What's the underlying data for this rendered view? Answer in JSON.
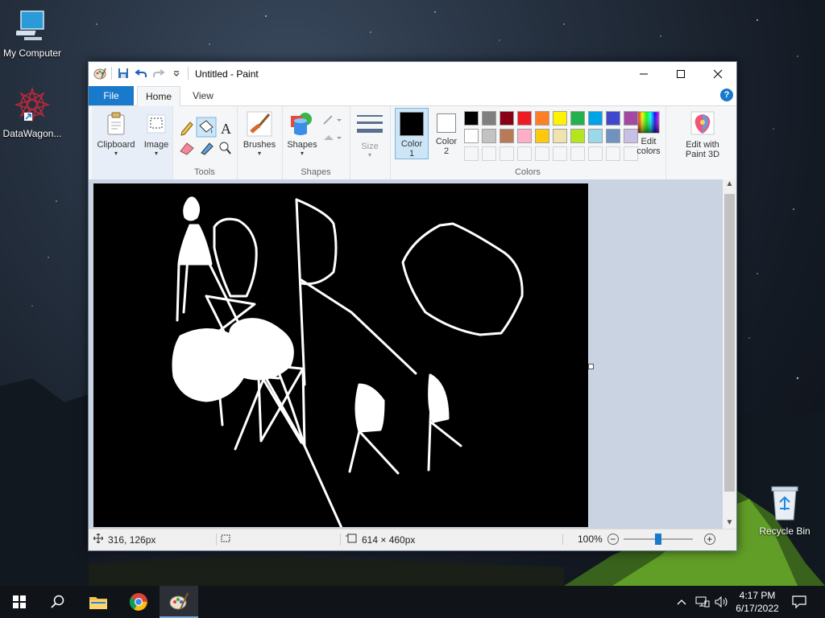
{
  "desktop": {
    "icons": [
      {
        "label": "My Computer"
      },
      {
        "label": "DataWagon..."
      },
      {
        "label": "Recycle Bin"
      }
    ]
  },
  "window": {
    "title": "Untitled - Paint",
    "tabs": {
      "file": "File",
      "home": "Home",
      "view": "View"
    },
    "help": "?"
  },
  "ribbon": {
    "clipboard": "Clipboard",
    "image": "Image",
    "tools_group": "Tools",
    "brushes": "Brushes",
    "shapes_btn": "Shapes",
    "shapes_group": "Shapes",
    "size": "Size",
    "color1": {
      "line1": "Color",
      "line2": "1",
      "value": "#000000"
    },
    "color2": {
      "line1": "Color",
      "line2": "2",
      "value": "#ffffff"
    },
    "edit_colors": {
      "line1": "Edit",
      "line2": "colors"
    },
    "edit_paint3d": {
      "line1": "Edit with",
      "line2": "Paint 3D"
    },
    "colors_group": "Colors",
    "palette_row1": [
      "#000000",
      "#7f7f7f",
      "#880015",
      "#ed1c24",
      "#ff7f27",
      "#fff200",
      "#22b14c",
      "#00a2e8",
      "#3f48cc",
      "#a349a4"
    ],
    "palette_row2": [
      "#ffffff",
      "#c3c3c3",
      "#b97a57",
      "#ffaec9",
      "#ffc90e",
      "#efe4b0",
      "#b5e61d",
      "#99d9ea",
      "#7092be",
      "#c8bfe7"
    ]
  },
  "status": {
    "cursor_pos": "316, 126px",
    "canvas_size": "614 × 460px",
    "zoom": "100%",
    "zoom_level": 1.0
  },
  "taskbar": {
    "time": "4:17 PM",
    "date": "6/17/2022"
  },
  "colors": {
    "accent": "#1979ca"
  }
}
